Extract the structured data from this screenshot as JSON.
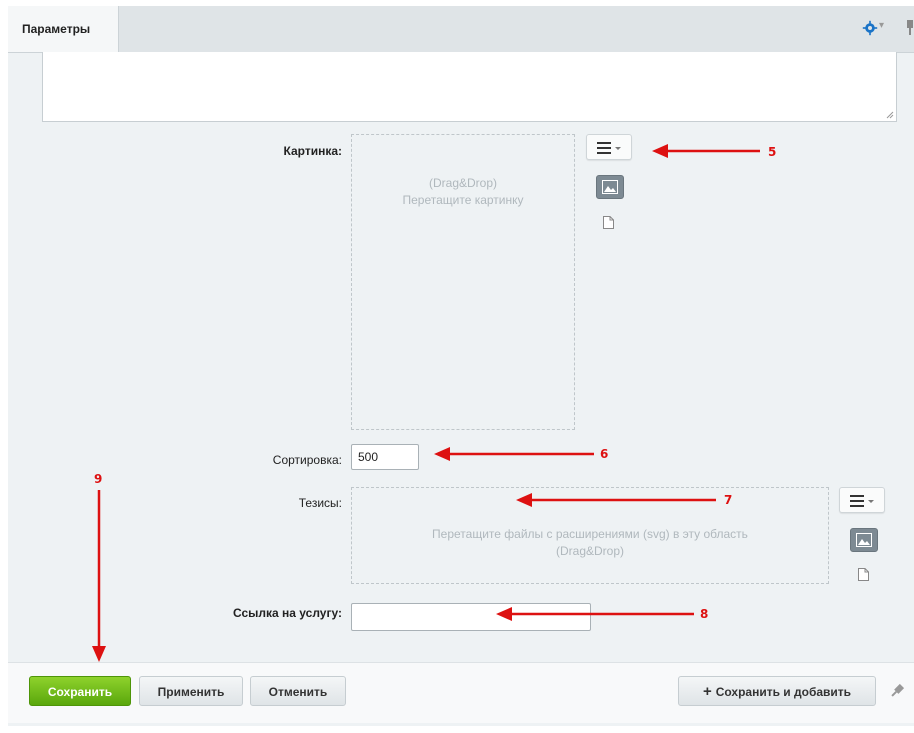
{
  "tab": {
    "label": "Параметры"
  },
  "fields": {
    "picture": {
      "label": "Картинка:",
      "dropzone_line1": "(Drag&Drop)",
      "dropzone_line2": "Перетащите картинку"
    },
    "sort": {
      "label": "Сортировка:",
      "value": "500"
    },
    "theses": {
      "label": "Тезисы:",
      "dropzone_line1": "Перетащите файлы с расширениями (svg) в эту область",
      "dropzone_line2": "(Drag&Drop)"
    },
    "link": {
      "label": "Ссылка на услугу:",
      "value": ""
    }
  },
  "footer": {
    "save": "Сохранить",
    "apply": "Применить",
    "cancel": "Отменить",
    "save_add": "Сохранить и добавить"
  },
  "annotations": {
    "n5": "5",
    "n6": "6",
    "n7": "7",
    "n8": "8",
    "n9": "9"
  },
  "colors": {
    "annotation": "#dd1111",
    "save_button": "#6cba17",
    "accent_gear": "#1a73c7"
  },
  "icons": [
    "gear-icon",
    "pin-icon",
    "menu-icon",
    "image-icon",
    "file-icon",
    "resize-handle-icon",
    "plus-icon"
  ]
}
